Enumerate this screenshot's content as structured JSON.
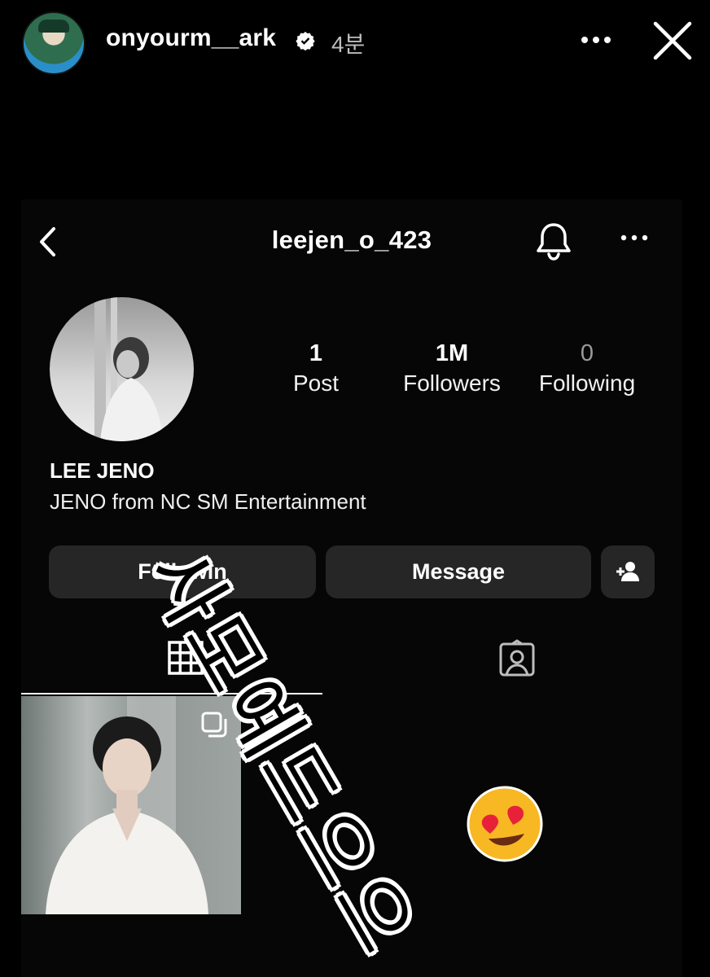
{
  "story": {
    "username": "onyourm__ark",
    "time": "4분"
  },
  "profile": {
    "username": "leejen_o_423",
    "stats": [
      {
        "value": "1",
        "label": "Post"
      },
      {
        "value": "1M",
        "label": "Followers"
      },
      {
        "value": "0",
        "label": "Following"
      }
    ],
    "display_name": "LEE JENO",
    "bio": "JENO from NC   SM Entertainment",
    "buttons": {
      "following": "Followin",
      "message": "Message"
    }
  },
  "sticker": {
    "text": "사모예드으으"
  },
  "colors": {
    "background": "#000000",
    "button": "#262626",
    "heart_emoji": "#e8213a",
    "emoji_face": "#f7b824"
  },
  "icons": [
    "verified-badge-icon",
    "more-icon",
    "close-icon",
    "back-icon",
    "bell-icon",
    "add-user-icon",
    "grid-icon",
    "tagged-icon",
    "multiple-posts-icon",
    "heart-eyes-emoji"
  ]
}
